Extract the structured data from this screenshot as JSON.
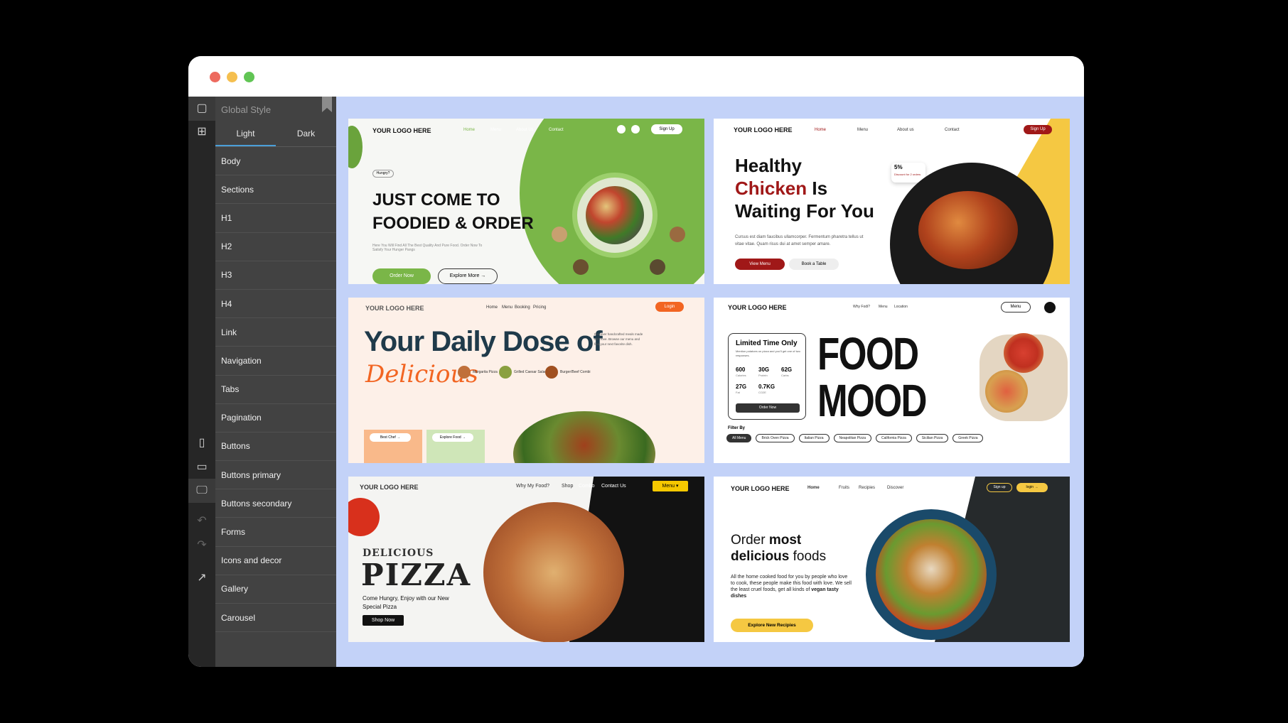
{
  "sidebar": {
    "title": "Global Style",
    "tabs": [
      "Light",
      "Dark"
    ],
    "items": [
      "Body",
      "Sections",
      "H1",
      "H2",
      "H3",
      "H4",
      "Link",
      "Navigation",
      "Tabs",
      "Pagination",
      "Buttons",
      "Buttons primary",
      "Buttons secondary",
      "Forms",
      "Icons and decor",
      "Gallery",
      "Carousel"
    ]
  },
  "cards": {
    "c1": {
      "logo": "YOUR LOGO HERE",
      "nav": [
        "Home",
        "Menu",
        "About Us",
        "Contact"
      ],
      "signup": "Sign Up",
      "badge": "Hungry?",
      "h1a": "JUST COME TO",
      "h1b": "FOODIED & ORDER",
      "sub": "Here You Will Find All The Best Quality And Pure Food. Order Now To Satisfy Your Hunger Pangs",
      "btn1": "Order Now",
      "btn2": "Explore More →"
    },
    "c2": {
      "logo": "YOUR LOGO HERE",
      "nav": [
        "Home",
        "Menu",
        "About us",
        "Contact"
      ],
      "signup": "Sign Up",
      "h1a": "Healthy",
      "h1b_red": "Chicken",
      "h1b_rest": " Is",
      "h1c": "Waiting For You",
      "body": "Cursus est diam faucibus ullamcorper. Fermentum pharetra tellus ut vitae vitae. Quam risus dui at amet semper amare.",
      "discount": "5%",
      "discount_note": "Discount for 2 orders",
      "btn1": "View Menu",
      "btn2": "Book a Table"
    },
    "c3": {
      "logo": "YOUR LOGO HERE",
      "nav": [
        "Home",
        "Menu",
        "Booking",
        "Pricing"
      ],
      "login": "Login",
      "h1": "Your Daily Dose of",
      "script": "Delicious",
      "side": "Discover handcrafted meals made with love. Browse our menu and find your next favorite dish.",
      "items": [
        "Margarita Pizza",
        "Grilled Caesar Salad",
        "Burger/Beef Combi"
      ],
      "chip1": "Best Chef →",
      "chip2": "Explore Food →"
    },
    "c4": {
      "logo": "YOUR LOGO HERE",
      "nav": [
        "Why Fodi?",
        "Menu",
        "Location"
      ],
      "menu": "Menu",
      "lto": "Limited Time Only",
      "lto_sub": "Mention potatoes on pizza and you'll get one of two responses.",
      "stats": [
        {
          "v": "600",
          "l": "Calories"
        },
        {
          "v": "30G",
          "l": "Protein"
        },
        {
          "v": "62G",
          "l": "Carbs"
        },
        {
          "v": "27G",
          "l": "Fat"
        },
        {
          "v": "0.7KG",
          "l": "CO2E"
        }
      ],
      "order": "Order Now",
      "word1": "FOOD",
      "word2": "MOOD",
      "filter": "Filter By",
      "filters": [
        "All Menu",
        "Brick Oven Pizza",
        "Italian Pizza",
        "Neapolitan Pizza",
        "California Pizza",
        "Sicilian Pizza",
        "Greek Pizza"
      ]
    },
    "c5": {
      "logo": "YOUR LOGO HERE",
      "nav": [
        "Why My Food?",
        "Shop",
        "Combo",
        "Contact Us"
      ],
      "menu": "Menu ▾",
      "small": "DELICIOUS",
      "big": "PIZZA",
      "sub": "Come Hungry, Enjoy with our New Special Pizza",
      "shop": "Shop Now"
    },
    "c6": {
      "logo": "YOUR LOGO HERE",
      "nav": [
        "Home",
        "Fruits",
        "Recipies",
        "Discover"
      ],
      "signup": "Sign up",
      "login": "login →",
      "h1a": "Order ",
      "h1a_b": "most",
      "h1b_b": "delicious",
      "h1b": " foods",
      "body": "All the home cooked food for you by people who love to cook, these people make this food with love. We sell the least cruel foods, get all kinds of",
      "body_b": " vegan tasty dishes",
      "btn": "Explore New Recipies"
    }
  },
  "colors": {
    "accent_green": "#7ab648",
    "accent_red": "#a01818",
    "accent_orange": "#f26522",
    "accent_yellow": "#f5c842",
    "canvas_bg": "#c3d2f8"
  }
}
